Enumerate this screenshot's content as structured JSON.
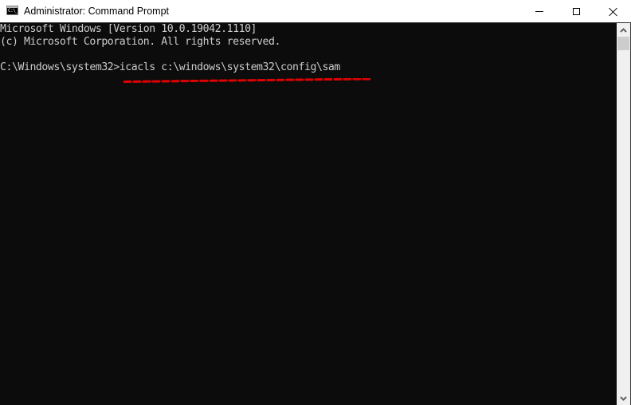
{
  "window": {
    "title": "Administrator: Command Prompt",
    "app_icon": "cmd-icon",
    "app_icon_text": "C:\\_",
    "controls": {
      "minimize": "minimize-icon",
      "maximize": "maximize-icon",
      "close": "close-icon"
    }
  },
  "console": {
    "background": "#0c0c0c",
    "foreground": "#cccccc",
    "lines": [
      "Microsoft Windows [Version 10.0.19042.1110]",
      "(c) Microsoft Corporation. All rights reserved.",
      "",
      "C:\\Windows\\system32>icacls c:\\windows\\system32\\config\\sam"
    ],
    "prompt": "C:\\Windows\\system32>",
    "command": "icacls c:\\windows\\system32\\config\\sam",
    "annotation": {
      "type": "dashed-underline",
      "color": "#e00000",
      "target": "command"
    }
  },
  "scrollbar": {
    "up_icon": "chevron-up-icon",
    "down_icon": "chevron-down-icon",
    "position": 0
  }
}
